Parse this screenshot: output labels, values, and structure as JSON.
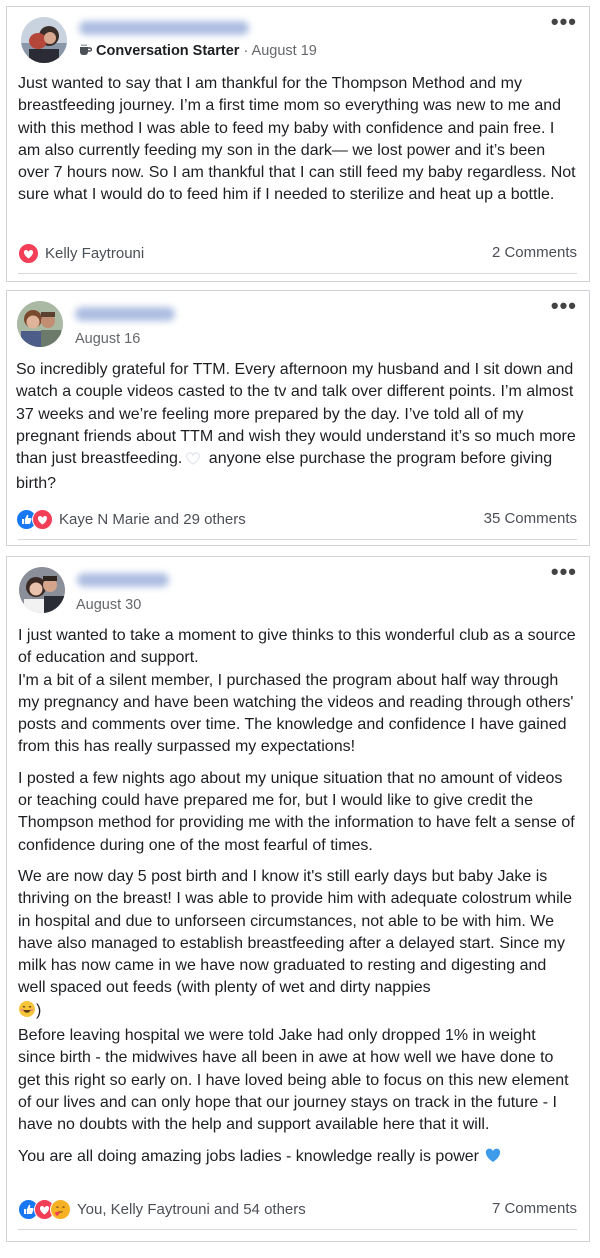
{
  "posts": [
    {
      "badge": "Conversation Starter",
      "date": "August 19",
      "body": [
        "Just wanted to say that I am thankful for the Thompson Method and my breastfeeding journey. I’m a first time mom so everything was new to me and with this method I was able to feed my baby with confidence and pain free. I am also currently feeding my son in the dark— we lost power and it’s been over 7 hours now. So I am thankful that I can still feed my baby regardless. Not sure what I would do to feed him if I needed to sterilize and heat up a bottle."
      ],
      "reactors": "Kelly Faytrouni",
      "comments": "2 Comments",
      "reactions": [
        "love"
      ]
    },
    {
      "date": "August 16",
      "body_part1": "So incredibly grateful for TTM. Every afternoon my husband and I sit down and watch a couple videos casted to the tv and talk over different points. I’m almost 37 weeks and we’re feeling more prepared by the day. I’ve told all of my pregnant friends about TTM and wish they would understand it’s so much more than just breastfeeding.",
      "body_part2": " anyone else purchase the program before giving birth?",
      "reactors": "Kaye N Marie and 29 others",
      "comments": "35 Comments",
      "reactions": [
        "like",
        "love"
      ]
    },
    {
      "date": "August 30",
      "paragraphs": [
        "I just wanted to take a moment to give thinks to this wonderful club as a source of education and support.",
        "I'm a bit of a silent member, I purchased the program about half way through my pregnancy and have been watching the videos and reading through others' posts and comments over time. The knowledge and confidence I have gained from this has really surpassed my expectations!",
        "I posted a few nights ago about my unique situation that no amount of videos or teaching could have prepared me for, but I would like to give credit the Thompson method for providing me with the information to have felt a sense of confidence during one of the most fearful of times.",
        "We are now day 5 post birth and I know it's still early days but baby Jake is thriving on the breast! I was able to provide him with adequate colostrum while in hospital and due to unforseen circumstances, not able to be with him. We have also managed to establish breastfeeding after a delayed start. Since my milk has now came in we have now graduated to resting and digesting and well spaced out feeds (with plenty of wet and dirty nappies",
        ")",
        "Before leaving hospital we were told Jake had only dropped 1% in weight since birth - the midwives have all been in awe at how well we have done to get this right so early on. I have loved being able to focus on this new element of our lives and can only hope that our journey stays on track in the future - I have no doubts with the help and support available here that it will.",
        "You are all doing amazing jobs ladies - knowledge really is power"
      ],
      "reactors": "You, Kelly Faytrouni and 54 others",
      "comments": "7 Comments",
      "reactions": [
        "like",
        "love",
        "care"
      ]
    }
  ]
}
